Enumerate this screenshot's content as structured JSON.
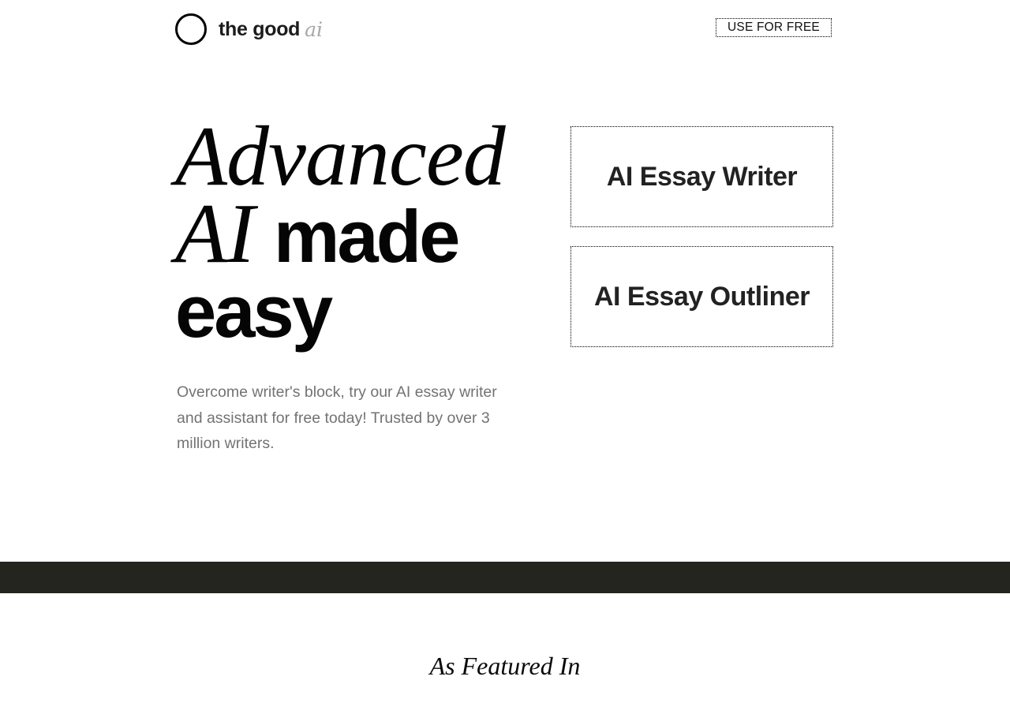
{
  "header": {
    "logo_text": "the good",
    "logo_ai": "ai",
    "cta_label": "USE FOR FREE"
  },
  "hero": {
    "line1": "Advanced",
    "line2_italic": "AI",
    "line2_bold": "made",
    "line3": "easy",
    "description": "Overcome writer's block, try our AI essay writer and assistant for free today! Trusted by over 3 million writers."
  },
  "tools": [
    {
      "label": "AI Essay Writer"
    },
    {
      "label": "AI Essay Outliner"
    }
  ],
  "featured": {
    "title": "As Featured In"
  },
  "colors": {
    "band": "#252520",
    "muted_text": "#737373",
    "logo_ai": "#a8a8a8"
  }
}
